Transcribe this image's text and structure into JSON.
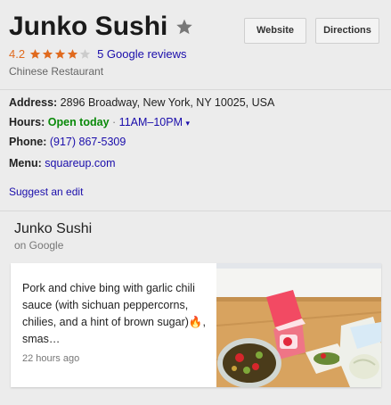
{
  "header": {
    "title": "Junko Sushi",
    "website_label": "Website",
    "directions_label": "Directions"
  },
  "rating": {
    "value": "4.2",
    "stars_filled": 4,
    "stars_total": 5,
    "reviews_text": "5 Google reviews"
  },
  "category": "Chinese Restaurant",
  "details": {
    "address_label": "Address:",
    "address_value": "2896 Broadway, New York, NY 10025, USA",
    "hours_label": "Hours:",
    "hours_status": "Open today",
    "hours_sep": "·",
    "hours_value": "11AM–10PM",
    "hours_arrow": "▾",
    "phone_label": "Phone:",
    "phone_value": "(917) 867-5309",
    "menu_label": "Menu:",
    "menu_value": "squareup.com"
  },
  "suggest_edit": "Suggest an edit",
  "post_section": {
    "title": "Junko Sushi",
    "subtitle": "on Google",
    "post": {
      "text": "Pork and chive bing with garlic chili sauce (with sichuan peppercorns, chilies, and a hint of brown sugar)🔥, smas…",
      "time": "22 hours ago"
    }
  },
  "colors": {
    "star_filled": "#e06a1e",
    "star_empty": "#cccccc",
    "link": "#1a0dab",
    "open": "#0a8a0a"
  }
}
